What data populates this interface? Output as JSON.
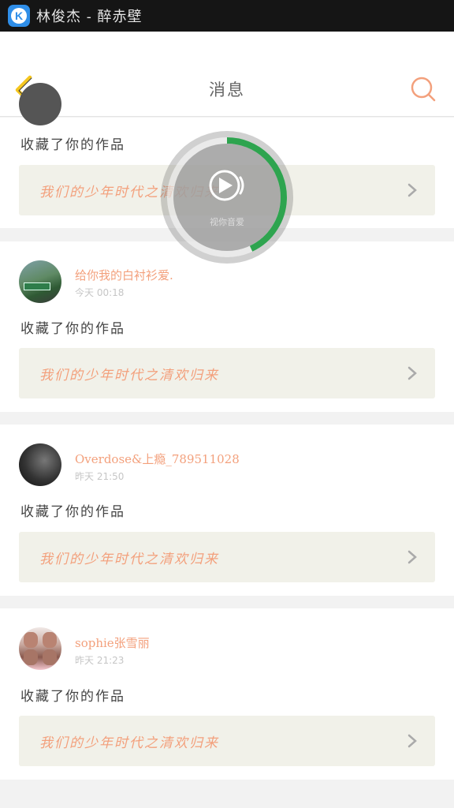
{
  "status_bar": {
    "now_playing": "林俊杰 - 醉赤壁",
    "app_icon_letter": "K"
  },
  "header": {
    "title": "消息",
    "back_icon": "chevron-left-icon",
    "search_icon": "search-icon"
  },
  "partial_card": {
    "action": "收藏了你的作品",
    "work_title": "我们的少年时代之清欢归来"
  },
  "messages": [
    {
      "username": "给你我的白衬衫爱.",
      "time": "今天 00:18",
      "action": "收藏了你的作品",
      "work_title": "我们的少年时代之清欢归来"
    },
    {
      "username": "Overdose&上瘾_789511028",
      "time": "昨天 21:50",
      "action": "收藏了你的作品",
      "work_title": "我们的少年时代之清欢归来"
    },
    {
      "username": "sophie张雪丽",
      "time": "昨天 21:23",
      "action": "收藏了你的作品",
      "work_title": "我们的少年时代之清欢归来"
    }
  ],
  "player_overlay": {
    "label": "视你音爱",
    "progress": 0.43
  },
  "colors": {
    "accent": "#f3a07c",
    "back": "#f5c61f",
    "progress": "#2ea44f"
  }
}
